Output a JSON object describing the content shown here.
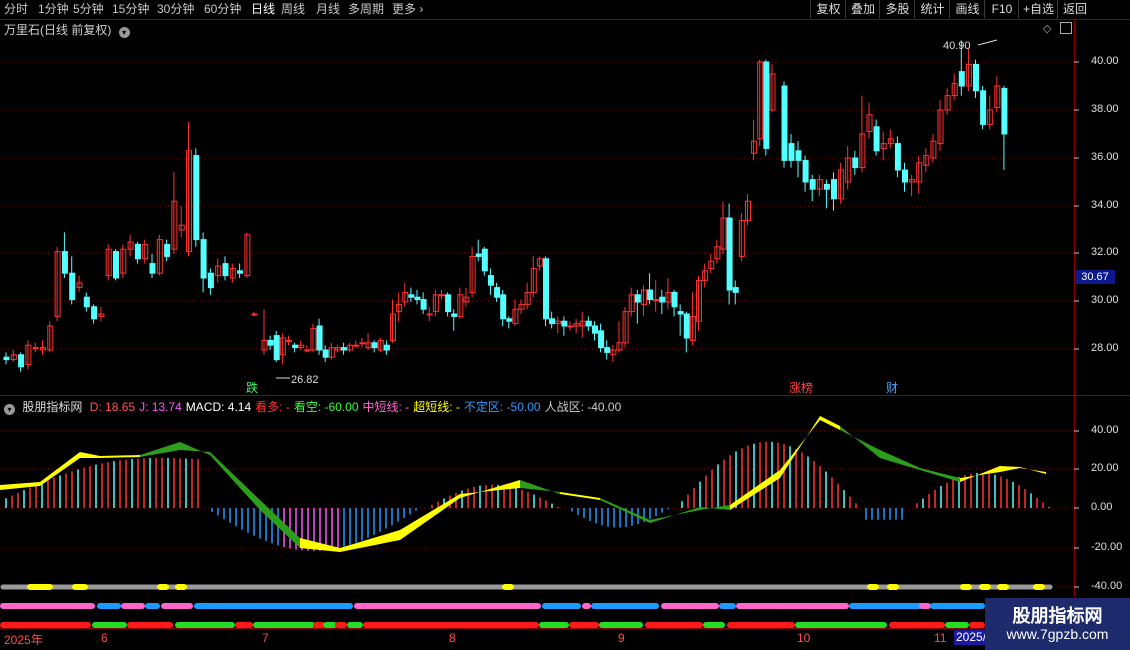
{
  "toolbar": {
    "periods": [
      "分时",
      "1分钟",
      "5分钟",
      "15分钟",
      "30分钟",
      "60分钟",
      "日线",
      "周线",
      "月线",
      "多周期",
      "更多"
    ],
    "active_period": "日线",
    "more_caret": "›",
    "tools": [
      "复权",
      "叠加",
      "多股",
      "统计",
      "画线",
      "F10",
      "+自选",
      "返回"
    ]
  },
  "main_chart": {
    "title": "万里石(日线 前复权)",
    "price_axis": [
      "40.00",
      "38.00",
      "36.00",
      "34.00",
      "32.00",
      "30.00",
      "28.00"
    ],
    "current_price": "30.67",
    "high_label": "40.90",
    "low_label": "26.82",
    "markers": [
      {
        "text": "跌",
        "color": "#33ff66"
      },
      {
        "text": "涨榜",
        "color": "#ff4444"
      },
      {
        "text": "财",
        "color": "#44aaff"
      }
    ]
  },
  "indicator": {
    "name": "股朋指标网",
    "items": [
      {
        "label": "D: 18.65",
        "color": "#ff5555"
      },
      {
        "label": "J: 13.74",
        "color": "#ff55ff"
      },
      {
        "label": "MACD: 4.14",
        "color": "#ffffff"
      },
      {
        "label": "看多: -",
        "color": "#ff3333"
      },
      {
        "label": "看空: -60.00",
        "color": "#33ff33"
      },
      {
        "label": "中短线: -",
        "color": "#ff66cc"
      },
      {
        "label": "超短线: -",
        "color": "#ffff00"
      },
      {
        "label": "不定区: -50.00",
        "color": "#3399ff"
      },
      {
        "label": "人战区: -40.00",
        "color": "#cccccc"
      }
    ],
    "axis": [
      "40.00",
      "20.00",
      "0.00",
      "-20.00",
      "-40.00"
    ]
  },
  "time_axis": [
    "2025年",
    "6",
    "7",
    "8",
    "9",
    "10",
    "11"
  ],
  "time_axis_highlight": "2025/",
  "watermark": {
    "title": "股朋指标网",
    "url": "www.7gpzb.com"
  },
  "colors": {
    "up": "#ff3232",
    "down": "#54ffff",
    "grid": "#8b0000",
    "yellow": "#ffff00",
    "green": "#2c9e1c",
    "pink": "#ff66cc",
    "blue": "#1a9bff",
    "gray": "#9a9a9a"
  }
}
